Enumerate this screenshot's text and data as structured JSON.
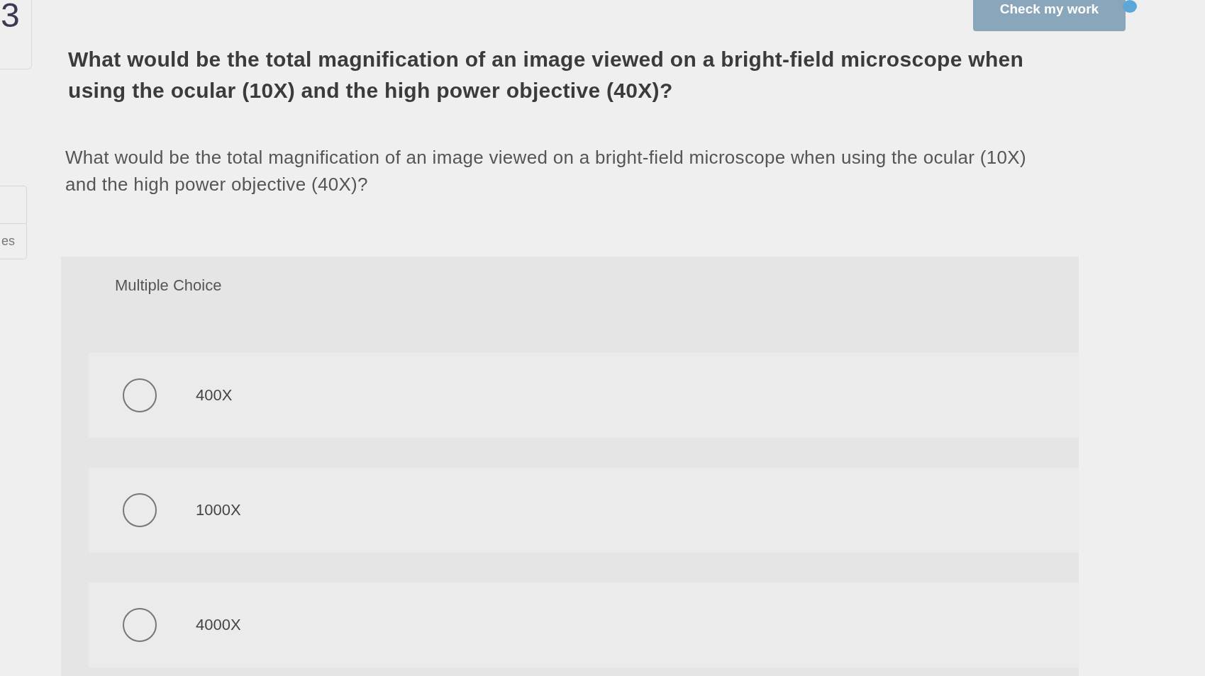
{
  "sidebar": {
    "question_number": "3",
    "tab_label": "es"
  },
  "header": {
    "check_button": {
      "label": "Check my work",
      "disabled": true
    }
  },
  "question": {
    "title": "What would be the total magnification of an image viewed on a bright-field microscope when using the ocular (10X) and the high power objective (40X)?",
    "text": "What would be the total magnification of an image viewed on a bright-field microscope when using the ocular (10X) and the high power objective (40X)?"
  },
  "multiple_choice": {
    "label": "Multiple Choice",
    "options": [
      {
        "label": "400X",
        "selected": false
      },
      {
        "label": "1000X",
        "selected": false
      },
      {
        "label": "4000X",
        "selected": false
      }
    ]
  }
}
